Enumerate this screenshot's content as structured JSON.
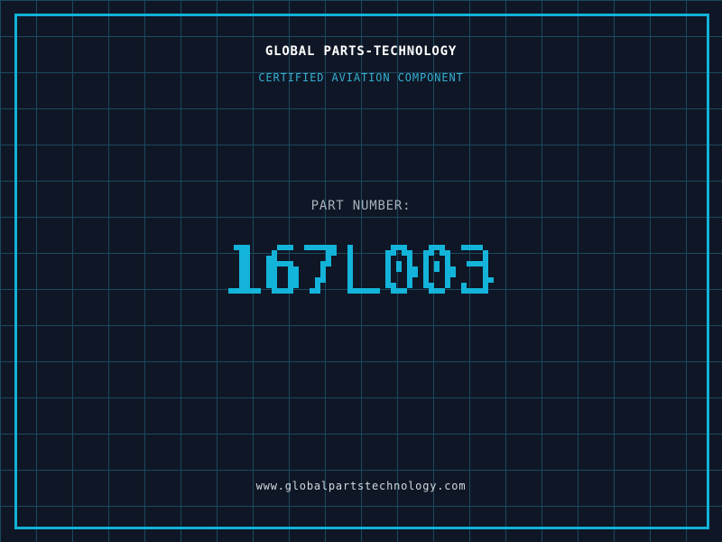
{
  "header": {
    "company_name": "GLOBAL PARTS-TECHNOLOGY",
    "certification": "CERTIFIED AVIATION COMPONENT"
  },
  "part": {
    "label": "PART NUMBER:",
    "number": "167L003"
  },
  "footer": {
    "website": "www.globalpartstechnology.com"
  },
  "colors": {
    "background": "#0f1726",
    "grid_line": "#1b495e",
    "frame_border": "#12b2d8",
    "part_number_cyan": "#14b4da",
    "certification_cyan": "#35aed2",
    "company_white": "#ffffff",
    "label_gray": "#a7b3bd",
    "website_gray": "#d3d9de"
  }
}
